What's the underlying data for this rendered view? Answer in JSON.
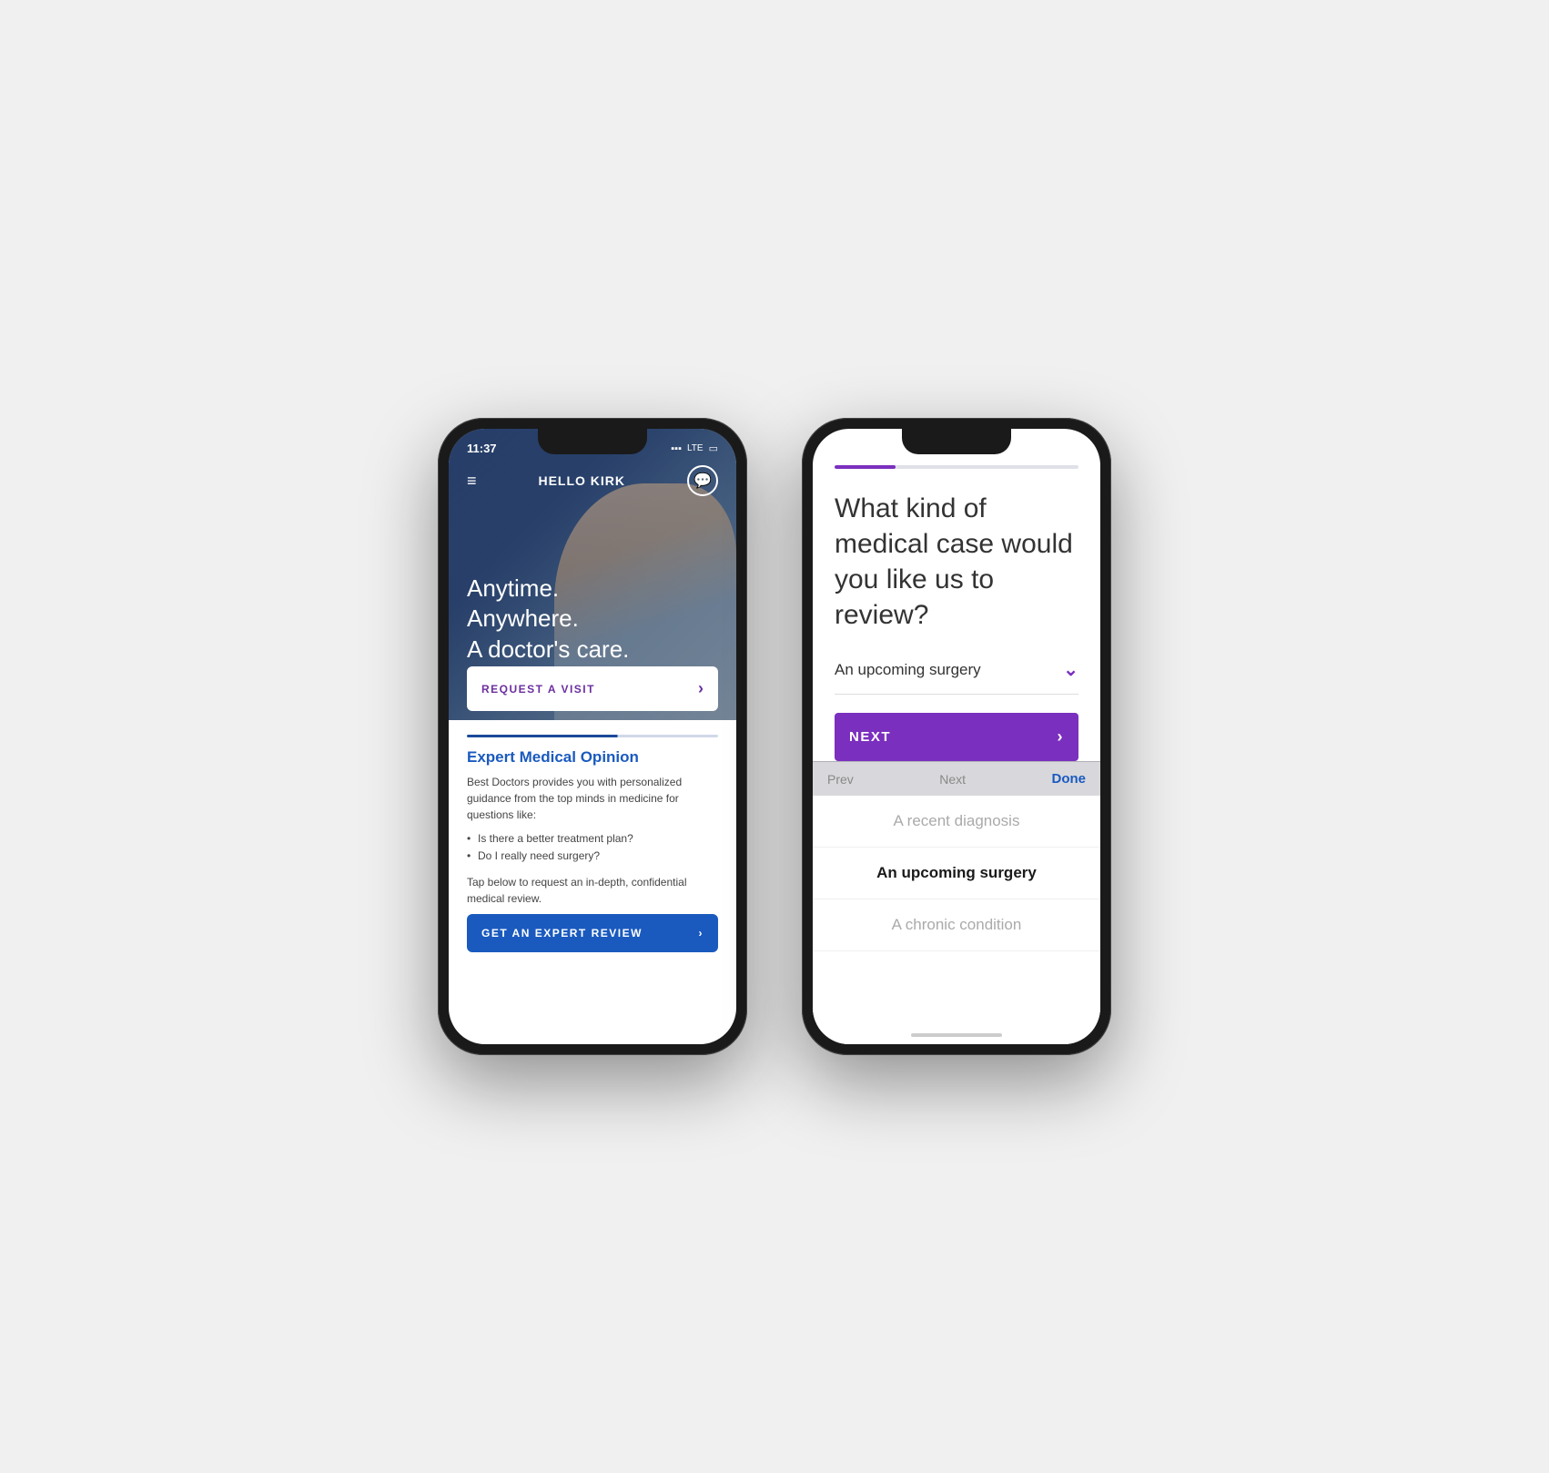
{
  "phone1": {
    "status_bar": {
      "time": "11:37",
      "signal": "📶 LTE",
      "battery": "🔋"
    },
    "nav": {
      "title": "HELLO KIRK"
    },
    "hero": {
      "headline_line1": "Anytime.",
      "headline_line2": "Anywhere.",
      "headline_line3": "A doctor's care."
    },
    "request_btn": {
      "label": "REQUEST A VISIT",
      "arrow": "›"
    },
    "section_title": "Expert Medical Opinion",
    "section_body": "Best Doctors provides you with personalized guidance from the top minds in medicine for questions like:",
    "bullets": [
      "Is there a better treatment plan?",
      "Do I really need surgery?"
    ],
    "tap_text": "Tap below to request an in-depth, confidential medical review.",
    "cta_label": "GET AN EXPERT REVIEW",
    "cta_arrow": "›"
  },
  "phone2": {
    "progress_pct": 25,
    "question": "What kind of medical case would you like us to review?",
    "dropdown_selected": "An upcoming surgery",
    "next_label": "NEXT",
    "next_arrow": "›",
    "toolbar": {
      "prev": "Prev",
      "next": "Next",
      "done": "Done"
    },
    "options": [
      {
        "label": "A recent diagnosis",
        "state": "muted"
      },
      {
        "label": "An upcoming surgery",
        "state": "active"
      },
      {
        "label": "A chronic condition",
        "state": "muted"
      }
    ]
  }
}
